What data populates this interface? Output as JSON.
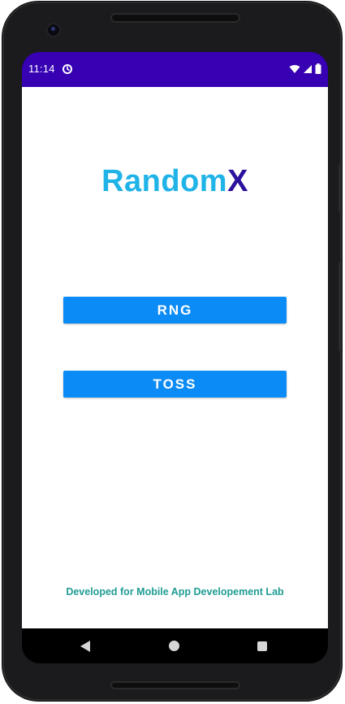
{
  "status_bar": {
    "time": "11:14",
    "background_color": "#3700b3",
    "sync_icon": "sync-icon",
    "wifi_icon": "wifi-icon",
    "signal_icon": "signal-icon",
    "battery_icon": "battery-icon"
  },
  "app": {
    "title_main": "Random",
    "title_accent": "X",
    "title_main_color": "#1fb3e8",
    "title_accent_color": "#2c119c",
    "buttons": {
      "rng_label": "RNG",
      "toss_label": "TOSS",
      "color": "#0b8bf5"
    },
    "footer": "Developed for Mobile App Developement Lab",
    "footer_color": "#1f9c94"
  },
  "navigation": {
    "back_icon": "back-icon",
    "home_icon": "home-icon",
    "recents_icon": "recents-icon"
  }
}
